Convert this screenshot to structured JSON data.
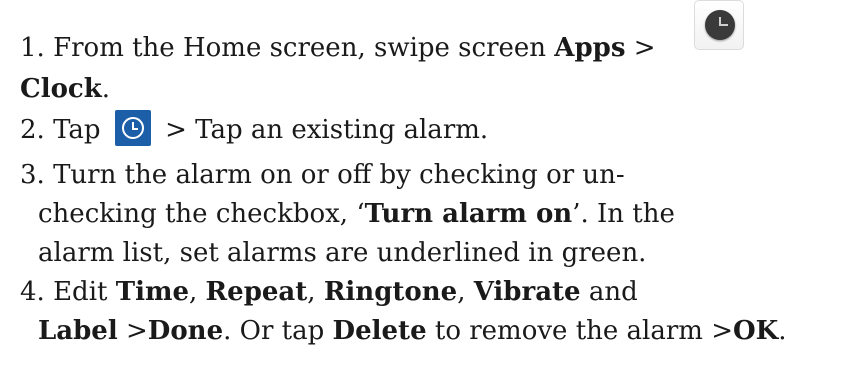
{
  "steps": {
    "s1": {
      "a": "1. From the Home screen, swipe screen ",
      "b": "Apps",
      "c": " >",
      "d": "Clock",
      "e": "."
    },
    "s2": {
      "a": "2. Tap",
      "b": " > Tap an existing alarm."
    },
    "s3": {
      "l1": "3. Turn the alarm on or off by checking or un-",
      "l2a": "checking the checkbox, ‘",
      "l2b": "Turn alarm on",
      "l2c": "’. In the",
      "l3": "alarm list, set alarms are underlined in green."
    },
    "s4": {
      "a": "4. Edit ",
      "b": "Time",
      "c": ", ",
      "d": "Repeat",
      "e": ", ",
      "f": "Ringtone",
      "g": ", ",
      "h": "Vibrate",
      "i": " and",
      "j": "Label",
      "k": " >",
      "l": "Done",
      "m": ". Or tap ",
      "n": "Delete",
      "o": " to remove the alarm >",
      "p": "OK",
      "q": "."
    }
  },
  "icons": {
    "clock_app": "clock-icon",
    "alarm_tab": "alarm-clock-icon"
  }
}
